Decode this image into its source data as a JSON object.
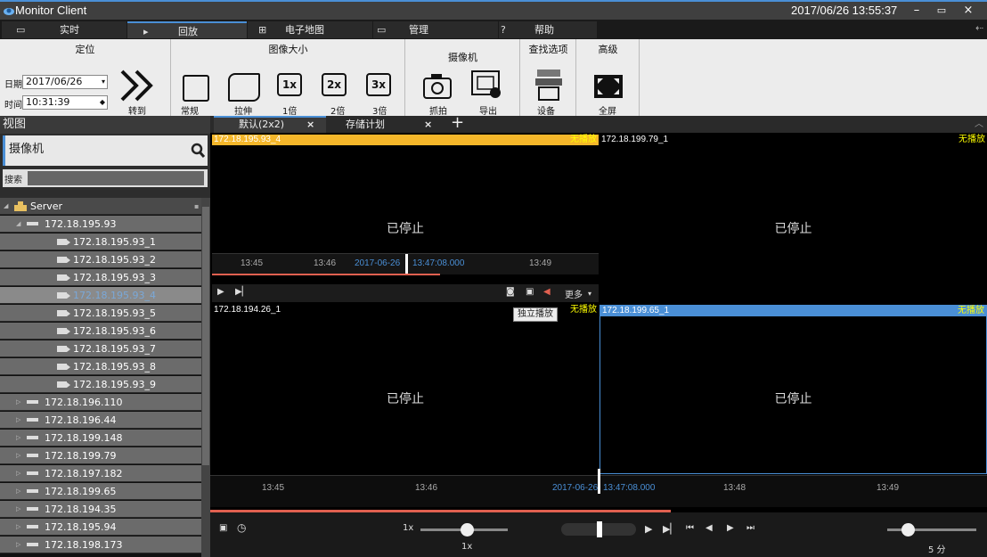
{
  "window": {
    "title": "Monitor Client",
    "datetime": "2017/06/26 13:55:37",
    "min": "–",
    "max": "▭",
    "close": "×"
  },
  "tabs": [
    {
      "label": "实时"
    },
    {
      "label": "回放"
    },
    {
      "label": "电子地图"
    },
    {
      "label": "管理"
    },
    {
      "label": "帮助"
    }
  ],
  "ribbon": {
    "locate": {
      "title": "定位",
      "date_label": "日期",
      "date_value": "2017/06/26",
      "time_label": "时间",
      "time_value": "10:31:39",
      "goto": "转到"
    },
    "image_size": {
      "title": "图像大小",
      "normal": "常规",
      "stretch": "拉伸",
      "x1": "1倍",
      "x2": "2倍",
      "x3": "3倍",
      "x1_icon": "1x",
      "x2_icon": "2x",
      "x3_icon": "3x"
    },
    "camera": {
      "title": "摄像机",
      "snapshot": "抓拍",
      "export": "导出"
    },
    "find": {
      "title": "查找选项",
      "device": "设备"
    },
    "advanced": {
      "title": "高级",
      "fullscreen": "全屏"
    }
  },
  "sidebar": {
    "header": "视图",
    "camera_title": "摄像机",
    "search_label": "搜索",
    "tree": [
      {
        "label": "Server"
      },
      {
        "label": "172.18.195.93"
      },
      {
        "label": "172.18.195.93_1"
      },
      {
        "label": "172.18.195.93_2"
      },
      {
        "label": "172.18.195.93_3"
      },
      {
        "label": "172.18.195.93_4"
      },
      {
        "label": "172.18.195.93_5"
      },
      {
        "label": "172.18.195.93_6"
      },
      {
        "label": "172.18.195.93_7"
      },
      {
        "label": "172.18.195.93_8"
      },
      {
        "label": "172.18.195.93_9"
      },
      {
        "label": "172.18.196.110"
      },
      {
        "label": "172.18.196.44"
      },
      {
        "label": "172.18.199.148"
      },
      {
        "label": "172.18.199.79"
      },
      {
        "label": "172.18.197.182"
      },
      {
        "label": "172.18.199.65"
      },
      {
        "label": "172.18.194.35"
      },
      {
        "label": "172.18.195.94"
      },
      {
        "label": "172.18.198.173"
      }
    ]
  },
  "view_tabs": [
    {
      "label": "默认(2x2)"
    },
    {
      "label": "存储计划"
    }
  ],
  "panes": [
    {
      "name": "172.18.195.93_4",
      "status": "无播放",
      "stopped": "已停止"
    },
    {
      "name": "172.18.199.79_1",
      "status": "无播放",
      "stopped": "已停止"
    },
    {
      "name": "172.18.194.26_1",
      "status": "无播放",
      "stopped": "已停止"
    },
    {
      "name": "172.18.199.65_1",
      "status": "无播放",
      "stopped": "已停止"
    }
  ],
  "mini_timeline": {
    "t1": "13:45",
    "t2": "13:46",
    "date": "2017-06-26",
    "cursor": "13:47:08.000",
    "t3": "13:49"
  },
  "pane_controls": {
    "more": "更多",
    "tooltip": "独立播放"
  },
  "timeline": {
    "t1": "13:45",
    "t2": "13:46",
    "date": "2017-06-26",
    "cursor": "13:47:08.000",
    "t3": "13:48",
    "t4": "13:49"
  },
  "bottom": {
    "speed_left": "1x",
    "speed_value": "1x",
    "zoom_value": "5 分"
  },
  "colors": {
    "accent": "#4a8fd6",
    "selected_header": "#f5b72a",
    "status": "#ffff00",
    "progress": "#e06050"
  }
}
